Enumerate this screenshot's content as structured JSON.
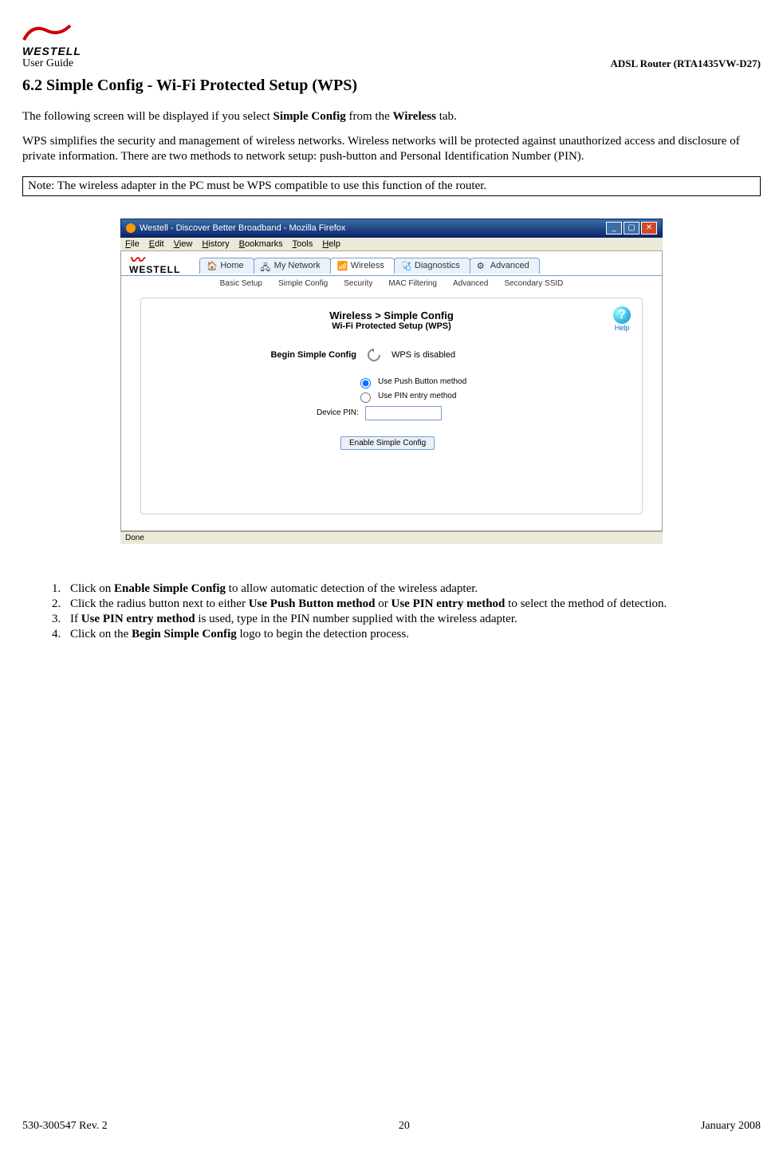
{
  "header": {
    "brand": "WESTELL",
    "left": "User Guide",
    "right": "ADSL Router (RTA1435VW-D27)"
  },
  "section_title": "6.2 Simple Config - Wi-Fi Protected Setup (WPS)",
  "intro_prefix": "The following screen will be displayed if you select ",
  "intro_bold1": "Simple Config",
  "intro_mid": " from the ",
  "intro_bold2": "Wireless",
  "intro_suffix": " tab.",
  "para2": "WPS simplifies the security and management of wireless networks. Wireless networks will be protected against unauthorized access and disclosure of private information. There are two methods to network setup: push-button and Personal Identification Number (PIN).",
  "note": "Note: The wireless adapter in the PC must be WPS compatible to use this function of the router.",
  "screenshot": {
    "title": "Westell - Discover Better Broadband - Mozilla Firefox",
    "menus": [
      "File",
      "Edit",
      "View",
      "History",
      "Bookmarks",
      "Tools",
      "Help"
    ],
    "brand": "WESTELL",
    "main_tabs": [
      "Home",
      "My Network",
      "Wireless",
      "Diagnostics",
      "Advanced"
    ],
    "sub_tabs": [
      "Basic Setup",
      "Simple Config",
      "Security",
      "MAC Filtering",
      "Advanced",
      "Secondary SSID"
    ],
    "panel_title": "Wireless > Simple Config",
    "panel_sub": "Wi-Fi Protected Setup (WPS)",
    "help_label": "Help",
    "begin_label": "Begin Simple Config",
    "wps_status": "WPS is disabled",
    "method_push": "Use Push Button method",
    "method_pin": "Use PIN entry method",
    "device_pin_label": "Device PIN:",
    "enable_button": "Enable Simple Config",
    "status_bar": "Done"
  },
  "steps": [
    {
      "pre": "Click on ",
      "b1": "Enable Simple Config",
      "post": " to allow automatic detection of the wireless adapter."
    },
    {
      "pre": "Click the radius button next to either ",
      "b1": "Use Push Button method",
      "mid": " or ",
      "b2": "Use PIN entry method",
      "post": " to select the method of detection."
    },
    {
      "pre": "If ",
      "b1": "Use PIN entry method",
      "post": " is used, type in the PIN number supplied with the wireless adapter."
    },
    {
      "pre": "Click on the ",
      "b1": "Begin Simple Config",
      "post": " logo to begin the detection process."
    }
  ],
  "footer": {
    "left": "530-300547 Rev. 2",
    "center": "20",
    "right": "January 2008"
  }
}
